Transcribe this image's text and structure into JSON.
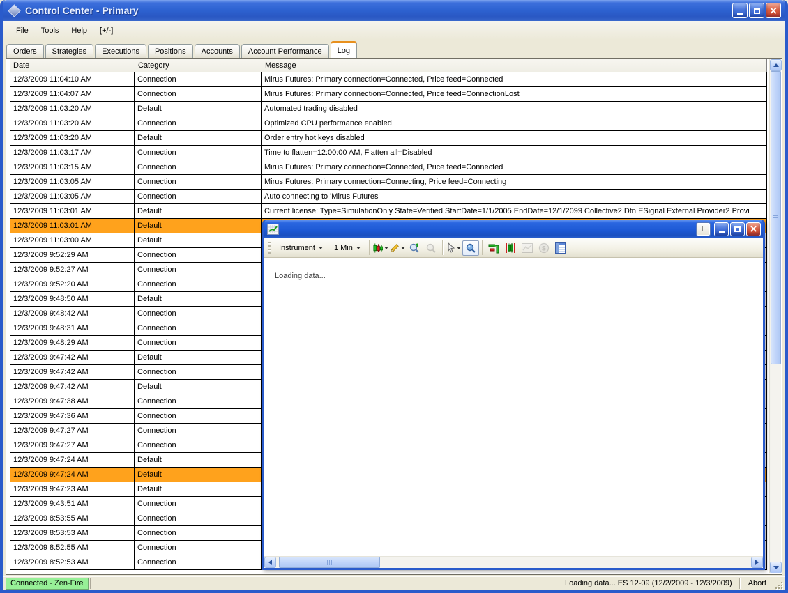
{
  "colors": {
    "title_blue": "#2E63D2",
    "window_border_blue": "#2A5BCB",
    "row_highlight_orange": "#FFA21C",
    "active_tab_orange": "#E8901D",
    "status_green": "#97F097",
    "chrome_beige": "#ECE9D8",
    "grid_line": "#000000"
  },
  "window": {
    "title": "Control Center - Primary"
  },
  "menu": {
    "items": [
      "File",
      "Tools",
      "Help",
      "[+/-]"
    ]
  },
  "tabs": {
    "active": "Log",
    "items": [
      "Orders",
      "Strategies",
      "Executions",
      "Positions",
      "Accounts",
      "Account Performance",
      "Log"
    ]
  },
  "log_table": {
    "columns": [
      "Date",
      "Category",
      "Message"
    ],
    "rows": [
      {
        "date": "12/3/2009 11:04:10 AM",
        "category": "Connection",
        "message": "Mirus Futures: Primary connection=Connected, Price feed=Connected",
        "highlight": false
      },
      {
        "date": "12/3/2009 11:04:07 AM",
        "category": "Connection",
        "message": "Mirus Futures: Primary connection=Connected, Price feed=ConnectionLost",
        "highlight": false
      },
      {
        "date": "12/3/2009 11:03:20 AM",
        "category": "Default",
        "message": "Automated trading disabled",
        "highlight": false
      },
      {
        "date": "12/3/2009 11:03:20 AM",
        "category": "Connection",
        "message": "Optimized CPU performance enabled",
        "highlight": false
      },
      {
        "date": "12/3/2009 11:03:20 AM",
        "category": "Default",
        "message": "Order entry hot keys disabled",
        "highlight": false
      },
      {
        "date": "12/3/2009 11:03:17 AM",
        "category": "Connection",
        "message": "Time to flatten=12:00:00 AM, Flatten all=Disabled",
        "highlight": false
      },
      {
        "date": "12/3/2009 11:03:15 AM",
        "category": "Connection",
        "message": "Mirus Futures: Primary connection=Connected, Price feed=Connected",
        "highlight": false
      },
      {
        "date": "12/3/2009 11:03:05 AM",
        "category": "Connection",
        "message": "Mirus Futures: Primary connection=Connecting, Price feed=Connecting",
        "highlight": false
      },
      {
        "date": "12/3/2009 11:03:05 AM",
        "category": "Connection",
        "message": "Auto connecting to 'Mirus Futures'",
        "highlight": false
      },
      {
        "date": "12/3/2009 11:03:01 AM",
        "category": "Default",
        "message": "Current license: Type=SimulationOnly State=Verified StartDate=1/1/2005 EndDate=12/1/2099 Collective2 Dtn ESignal External Provider2 Provi",
        "highlight": false
      },
      {
        "date": "12/3/2009 11:03:01 AM",
        "category": "Default",
        "message": "",
        "highlight": true
      },
      {
        "date": "12/3/2009 11:03:00 AM",
        "category": "Default",
        "message": "",
        "highlight": false
      },
      {
        "date": "12/3/2009 9:52:29 AM",
        "category": "Connection",
        "message": "",
        "highlight": false
      },
      {
        "date": "12/3/2009 9:52:27 AM",
        "category": "Connection",
        "message": "",
        "highlight": false
      },
      {
        "date": "12/3/2009 9:52:20 AM",
        "category": "Connection",
        "message": "",
        "highlight": false
      },
      {
        "date": "12/3/2009 9:48:50 AM",
        "category": "Default",
        "message": "",
        "highlight": false
      },
      {
        "date": "12/3/2009 9:48:42 AM",
        "category": "Connection",
        "message": "",
        "highlight": false
      },
      {
        "date": "12/3/2009 9:48:31 AM",
        "category": "Connection",
        "message": "",
        "highlight": false
      },
      {
        "date": "12/3/2009 9:48:29 AM",
        "category": "Connection",
        "message": "",
        "highlight": false
      },
      {
        "date": "12/3/2009 9:47:42 AM",
        "category": "Default",
        "message": "",
        "highlight": false
      },
      {
        "date": "12/3/2009 9:47:42 AM",
        "category": "Connection",
        "message": "",
        "highlight": false
      },
      {
        "date": "12/3/2009 9:47:42 AM",
        "category": "Default",
        "message": "",
        "highlight": false
      },
      {
        "date": "12/3/2009 9:47:38 AM",
        "category": "Connection",
        "message": "",
        "highlight": false
      },
      {
        "date": "12/3/2009 9:47:36 AM",
        "category": "Connection",
        "message": "",
        "highlight": false
      },
      {
        "date": "12/3/2009 9:47:27 AM",
        "category": "Connection",
        "message": "",
        "highlight": false
      },
      {
        "date": "12/3/2009 9:47:27 AM",
        "category": "Connection",
        "message": "",
        "highlight": false
      },
      {
        "date": "12/3/2009 9:47:24 AM",
        "category": "Default",
        "message": "",
        "highlight": false
      },
      {
        "date": "12/3/2009 9:47:24 AM",
        "category": "Default",
        "message": "",
        "highlight": true
      },
      {
        "date": "12/3/2009 9:47:23 AM",
        "category": "Default",
        "message": "",
        "highlight": false
      },
      {
        "date": "12/3/2009 9:43:51 AM",
        "category": "Connection",
        "message": "",
        "highlight": false
      },
      {
        "date": "12/3/2009 8:53:55 AM",
        "category": "Connection",
        "message": "",
        "highlight": false
      },
      {
        "date": "12/3/2009 8:53:53 AM",
        "category": "Connection",
        "message": "",
        "highlight": false
      },
      {
        "date": "12/3/2009 8:52:55 AM",
        "category": "Connection",
        "message": "",
        "highlight": false
      },
      {
        "date": "12/3/2009 8:52:53 AM",
        "category": "Connection",
        "message": "",
        "highlight": false
      }
    ]
  },
  "chart_window": {
    "title": "",
    "l_button_label": "L",
    "toolbar": {
      "instrument_label": "Instrument",
      "interval_label": "1 Min",
      "icons": [
        "chart-style-icon",
        "draw-tool-icon",
        "zoom-in-icon",
        "zoom-out-icon",
        "cursor-icon",
        "data-box-icon",
        "markers-icon",
        "chart-trader-icon",
        "snapshot-icon",
        "strategies-icon",
        "data-grid-icon"
      ]
    },
    "body_text": "Loading data..."
  },
  "status_bar": {
    "connection_status": "Connected - Zen-Fire",
    "loading_status": "Loading data... ES 12-09  (12/2/2009 - 12/3/2009)",
    "abort_label": "Abort"
  }
}
